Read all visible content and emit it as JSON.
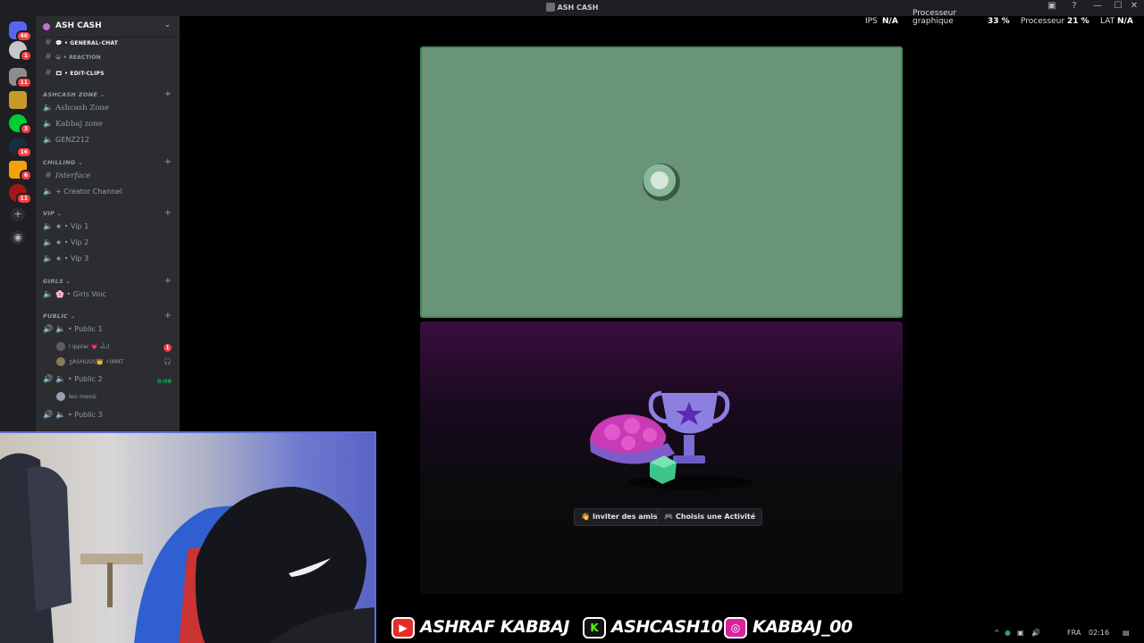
{
  "window": {
    "title": "ASH CASH",
    "minimize": "—",
    "maximize": "☐",
    "close": "✕"
  },
  "rail": {
    "badges": [
      "40",
      "1",
      "11",
      "3",
      "16",
      "6",
      "11"
    ]
  },
  "server": {
    "name": "ASH CASH",
    "chevron": "⌄"
  },
  "channels": {
    "text": [
      {
        "label": "💬 • GENERAL-CHAT"
      },
      {
        "label": "😀 • REACTION"
      },
      {
        "label": "🎞 • EDIT-CLIPS"
      }
    ],
    "categories": [
      "ASHCASH ZONE ⌄",
      "CHILLING ⌄",
      "VIP ⌄",
      "GIRLS ⌄",
      "PUBLIC ⌄"
    ],
    "zone": [
      "Ashcash Zone",
      "Kabbaj zone",
      "GENZ212"
    ],
    "chilling": [
      "Interface",
      "+ Creator Channel"
    ],
    "vip": [
      "★ • Vip 1",
      "★ • Vip 2",
      "★ • Vip 3"
    ],
    "girls": [
      "🌸 • Girls Voic"
    ],
    "public": [
      "• Public 1",
      "• Public 2",
      "• Public 3"
    ],
    "public1_users": [
      "l ipplar 💗 ﻙﺄﺪ",
      "ʒASHUUS👑 ⚡IMRT"
    ],
    "public2_users": [
      "leo messi"
    ],
    "public1_mention": "1",
    "public2_timer": "0:08"
  },
  "stats": {
    "ips_label": "IPS",
    "ips_value": "N/A",
    "gpu_label_1": "Processeur",
    "gpu_label_2": "graphique",
    "gpu_value": "33 %",
    "cpu_label": "Processeur",
    "cpu_value": "21 %",
    "lat_label": "LAT",
    "lat_value": "N/A"
  },
  "activity": {
    "invite_icon": "👋",
    "invite_label": "Inviter des amis",
    "choose_icon": "🎮",
    "choose_label": "Choisis une Activité"
  },
  "socials": [
    {
      "icon": "youtube-icon",
      "logo": "▶",
      "handle": "ASHRAF KABBAJ",
      "color": "#e52d27"
    },
    {
      "icon": "kick-icon",
      "logo": "K",
      "handle": "ASHCASH10",
      "color": "#111111"
    },
    {
      "icon": "instagram-icon",
      "logo": "◎",
      "handle": "KABBAJ_00",
      "color": "#d6249f"
    }
  ],
  "tray": {
    "lang": "FRA",
    "time": "02:16"
  }
}
